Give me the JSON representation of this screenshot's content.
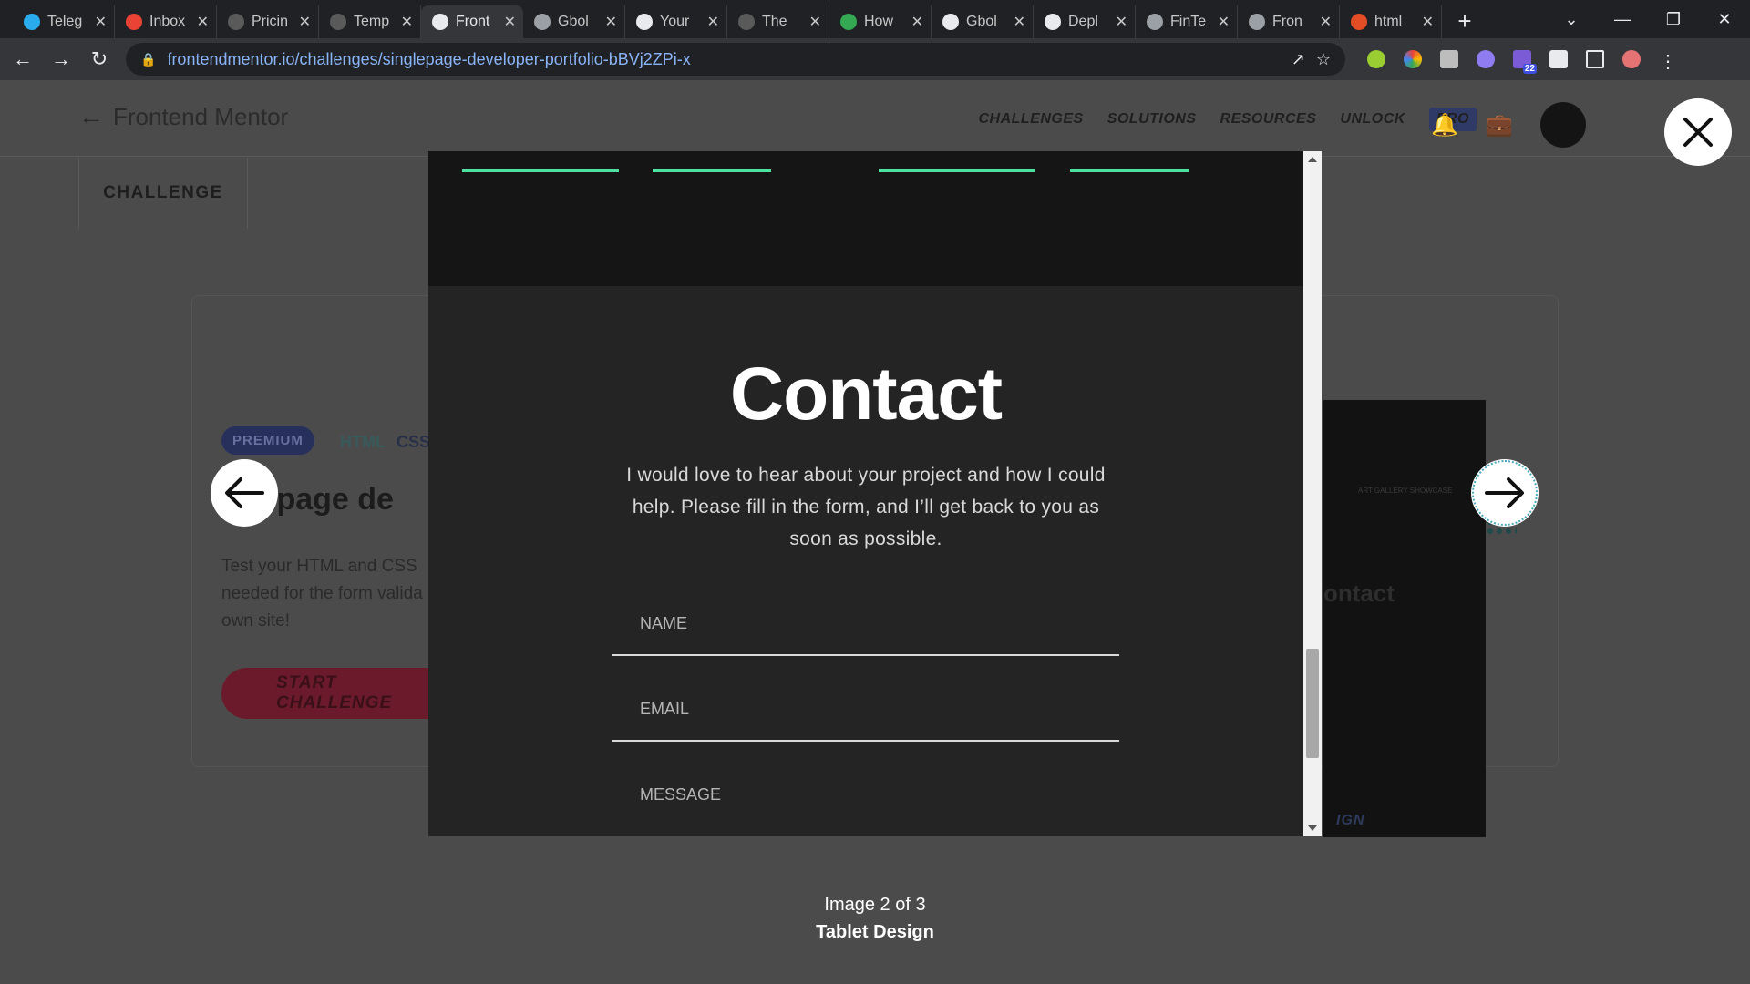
{
  "browser": {
    "tabs": [
      {
        "title": "Teleg",
        "icon": "telegram-icon",
        "color": "#2aabee"
      },
      {
        "title": "Inbox",
        "icon": "gmail-icon",
        "color": "#ea4335"
      },
      {
        "title": "Pricin",
        "icon": "b-icon",
        "color": "#5a5a5a"
      },
      {
        "title": "Temp",
        "icon": "b-icon",
        "color": "#5a5a5a"
      },
      {
        "title": "Front",
        "icon": "frontendmentor-icon",
        "color": "#e8eaed"
      },
      {
        "title": "Gbol",
        "icon": "globe-icon",
        "color": "#9aa0a6"
      },
      {
        "title": "Your",
        "icon": "github-icon",
        "color": "#e8eaed"
      },
      {
        "title": "The",
        "icon": "b-icon",
        "color": "#5a5a5a"
      },
      {
        "title": "How",
        "icon": "link-icon",
        "color": "#34a853"
      },
      {
        "title": "Gbol",
        "icon": "github-icon",
        "color": "#e8eaed"
      },
      {
        "title": "Depl",
        "icon": "github-icon",
        "color": "#e8eaed"
      },
      {
        "title": "FinTe",
        "icon": "globe-icon",
        "color": "#9aa0a6"
      },
      {
        "title": "Fron",
        "icon": "globe-icon",
        "color": "#9aa0a6"
      },
      {
        "title": "html",
        "icon": "html5-icon",
        "color": "#e44d26"
      }
    ],
    "url": "frontendmentor.io/challenges/singlepage-developer-portfolio-bBVj2ZPi-x",
    "extension_badge": "22"
  },
  "site": {
    "logo": "Frontend Mentor",
    "nav": [
      "CHALLENGES",
      "SOLUTIONS",
      "RESOURCES",
      "UNLOCK"
    ],
    "pro": "PRO",
    "challenge_tab": "CHALLENGE"
  },
  "card": {
    "badge": "PREMIUM",
    "tag_html": "HTML",
    "tag_css": "CSS",
    "title": "Single-page developer portfolio",
    "title_visible": "gle-page de",
    "desc": "Test your HTML and CSS skills. JavaScript will be needed for the form validation. Then add it to your own site!",
    "desc_visible": "Test your HTML and CSS needed for the form valida own site!",
    "start": "START CHALLENGE",
    "preview_contact": "ontact",
    "preview_label": "ART GALLERY SHOWCASE",
    "preview_design": "IGN"
  },
  "lightbox": {
    "title": "Contact",
    "text": "I would love to hear about your project and how I could help. Please fill in the form, and I’ll get back to you as soon as possible.",
    "fields": [
      "NAME",
      "EMAIL",
      "MESSAGE"
    ],
    "accent": "#4ee1a0",
    "caption_index": "Image 2 of 3",
    "caption_name": "Tablet Design"
  }
}
